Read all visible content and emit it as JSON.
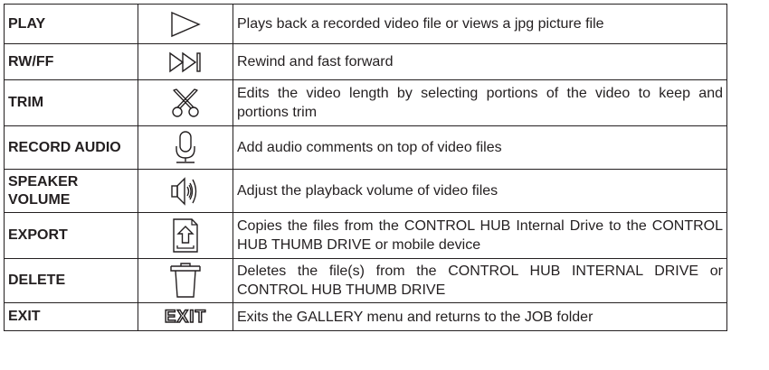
{
  "rows": [
    {
      "id": "play",
      "name": "PLAY",
      "icon": "play-icon",
      "description": "Plays back a recorded video file or views a jpg picture file"
    },
    {
      "id": "rwff",
      "name": "RW/FF",
      "icon": "rewind-fast-forward-icon",
      "description": "Rewind and fast forward"
    },
    {
      "id": "trim",
      "name": "TRIM",
      "icon": "scissors-icon",
      "description": "Edits the video length by selecting portions of the video to keep and portions trim"
    },
    {
      "id": "record_audio",
      "name": "RECORD AUDIO",
      "icon": "microphone-icon",
      "description": "Add audio comments on top of video files"
    },
    {
      "id": "speaker_volume",
      "name": "SPEAKER VOLUME",
      "icon": "speaker-icon",
      "description": "Adjust the playback volume of video files"
    },
    {
      "id": "export",
      "name": "EXPORT",
      "icon": "export-icon",
      "description": "Copies the files from the CONTROL HUB Internal Drive to the CONTROL HUB THUMB DRIVE or mobile device"
    },
    {
      "id": "delete",
      "name": "DELETE",
      "icon": "trash-icon",
      "description": "Deletes the file(s) from the CONTROL HUB INTERNAL DRIVE or CONTROL HUB THUMB DRIVE"
    },
    {
      "id": "exit",
      "name": "EXIT",
      "icon": "exit-icon",
      "icon_text": "EXIT",
      "description": "Exits the GALLERY menu and returns to the JOB folder"
    }
  ]
}
